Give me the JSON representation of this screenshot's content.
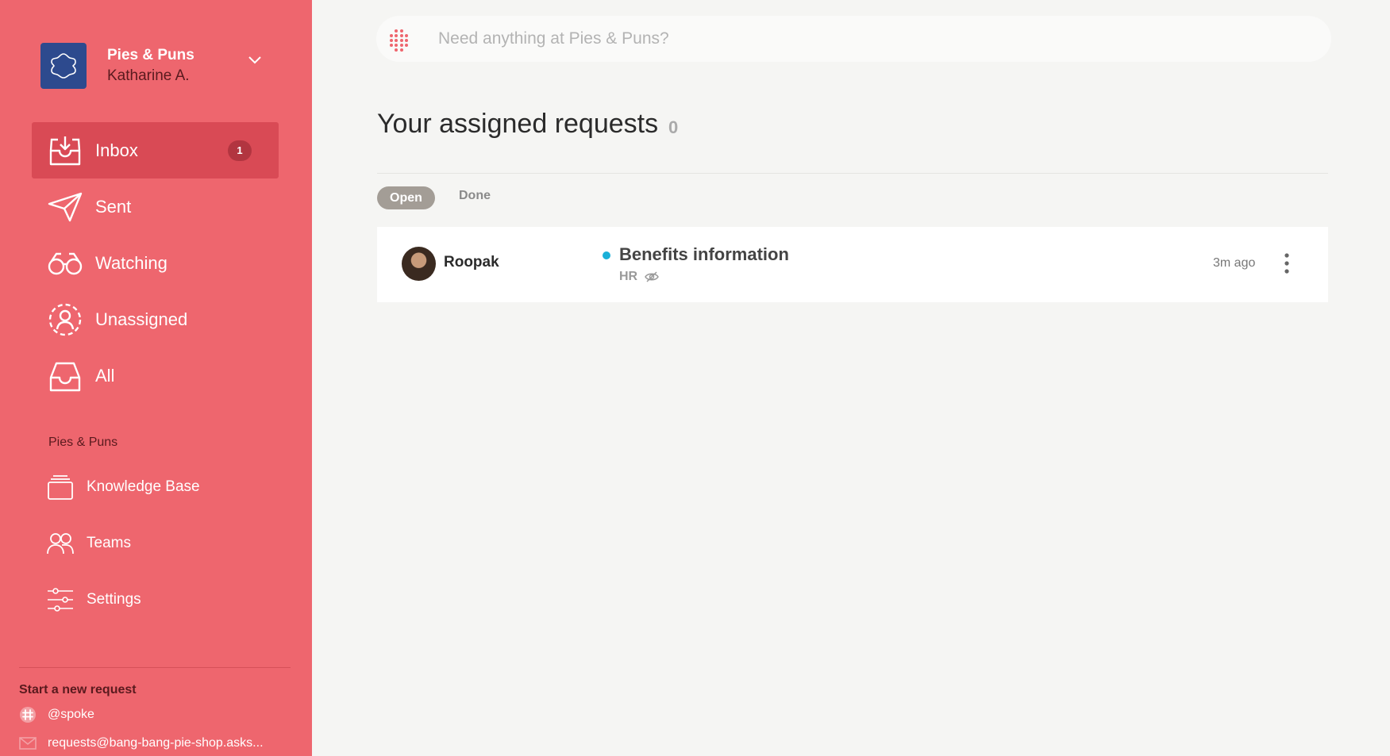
{
  "workspace": {
    "name": "Pies & Puns",
    "user": "Katharine A."
  },
  "nav": {
    "inbox": {
      "label": "Inbox",
      "badge": "1"
    },
    "sent": {
      "label": "Sent"
    },
    "watching": {
      "label": "Watching"
    },
    "unassigned": {
      "label": "Unassigned"
    },
    "all": {
      "label": "All"
    }
  },
  "section": {
    "label": "Pies & Puns",
    "knowledge_base": "Knowledge Base",
    "teams": "Teams",
    "settings": "Settings"
  },
  "start": {
    "label": "Start a new request",
    "slack": "@spoke",
    "email": "requests@bang-bang-pie-shop.asks..."
  },
  "search": {
    "placeholder": "Need anything at Pies & Puns?"
  },
  "page": {
    "title": "Your assigned requests",
    "count": "0"
  },
  "tabs": {
    "open": "Open",
    "done": "Done"
  },
  "requests": [
    {
      "requester": "Roopak",
      "title": "Benefits information",
      "team": "HR",
      "time": "3m ago",
      "status_color": "#1ab0d8"
    }
  ],
  "colors": {
    "sidebar": "#ee666e",
    "active": "#d94a55",
    "accent": "#1ab0d8"
  }
}
